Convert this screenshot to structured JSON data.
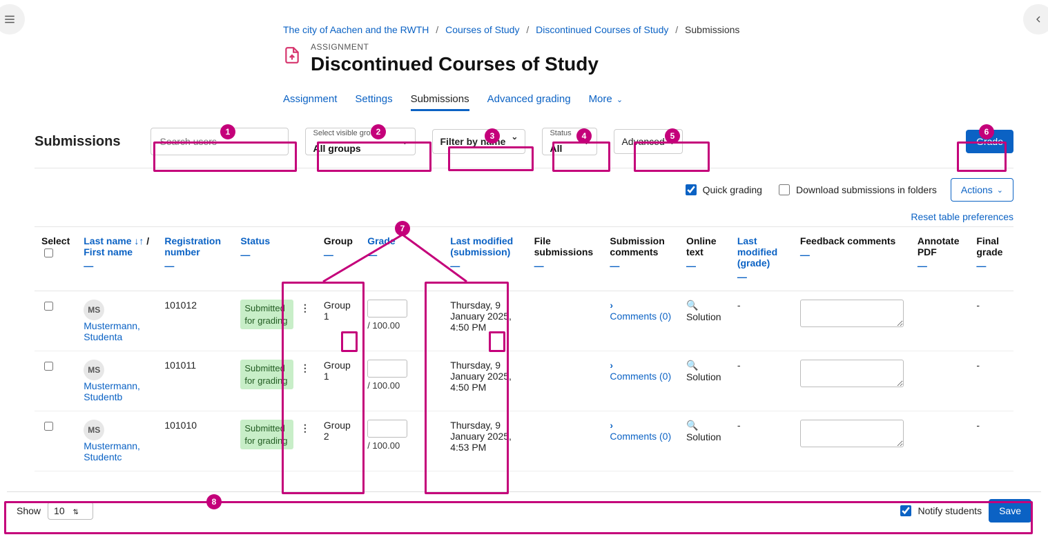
{
  "breadcrumb": {
    "items": [
      {
        "label": "The city of Aachen and the RWTH",
        "link": true
      },
      {
        "label": "Courses of Study",
        "link": true
      },
      {
        "label": "Discontinued Courses of Study",
        "link": true
      },
      {
        "label": "Submissions",
        "link": false
      }
    ]
  },
  "heading": {
    "eyebrow": "ASSIGNMENT",
    "title": "Discontinued Courses of Study"
  },
  "tabs": {
    "items": [
      {
        "label": "Assignment"
      },
      {
        "label": "Settings"
      },
      {
        "label": "Submissions",
        "active": true
      },
      {
        "label": "Advanced grading"
      },
      {
        "label": "More",
        "caret": true
      }
    ]
  },
  "filters": {
    "title": "Submissions",
    "search_placeholder": "Search users",
    "groups": {
      "label": "Select visible groups",
      "value": "All groups"
    },
    "name_filter": {
      "value": "Filter by name"
    },
    "status": {
      "label": "Status",
      "value": "All"
    },
    "advanced": {
      "value": "Advanced"
    },
    "grade_button": "Grade"
  },
  "options": {
    "quick_grading": {
      "label": "Quick grading",
      "checked": true
    },
    "download_folders": {
      "label": "Download submissions in folders",
      "checked": false
    },
    "actions_button": "Actions"
  },
  "reset_link": "Reset table preferences",
  "table": {
    "headers": {
      "select": "Select",
      "last_name": "Last name",
      "first_name": "First name",
      "reg": "Registration number",
      "status": "Status",
      "group": "Group",
      "grade": "Grade",
      "last_mod_sub": "Last modified (submission)",
      "file_sub": "File submissions",
      "sub_comments": "Submission comments",
      "online_text": "Online text",
      "last_mod_grade": "Last modified (grade)",
      "feedback": "Feedback comments",
      "annotate": "Annotate PDF",
      "final_grade": "Final grade"
    },
    "grade_denom": "/ 100.00",
    "rows": [
      {
        "initials": "MS",
        "name": "Mustermann, Studenta",
        "reg": "101012",
        "status": "Submitted for grading",
        "group": "Group 1",
        "last_mod_sub": "Thursday, 9 January 2025, 4:50 PM",
        "comments_label": "Comments (0)",
        "online_text": "Solution",
        "last_mod_grade": "-",
        "final_grade": "-"
      },
      {
        "initials": "MS",
        "name": "Mustermann, Studentb",
        "reg": "101011",
        "status": "Submitted for grading",
        "group": "Group 1",
        "last_mod_sub": "Thursday, 9 January 2025, 4:50 PM",
        "comments_label": "Comments (0)",
        "online_text": "Solution",
        "last_mod_grade": "-",
        "final_grade": "-"
      },
      {
        "initials": "MS",
        "name": "Mustermann, Studentc",
        "reg": "101010",
        "status": "Submitted for grading",
        "group": "Group 2",
        "last_mod_sub": "Thursday, 9 January 2025, 4:53 PM",
        "comments_label": "Comments (0)",
        "online_text": "Solution",
        "last_mod_grade": "-",
        "final_grade": "-"
      }
    ]
  },
  "footer": {
    "show_label": "Show",
    "show_value": "10",
    "notify": {
      "label": "Notify students",
      "checked": true
    },
    "save_button": "Save"
  },
  "annotations": {
    "1": "1",
    "2": "2",
    "3": "3",
    "4": "4",
    "5": "5",
    "6": "6",
    "7": "7",
    "8": "8"
  }
}
